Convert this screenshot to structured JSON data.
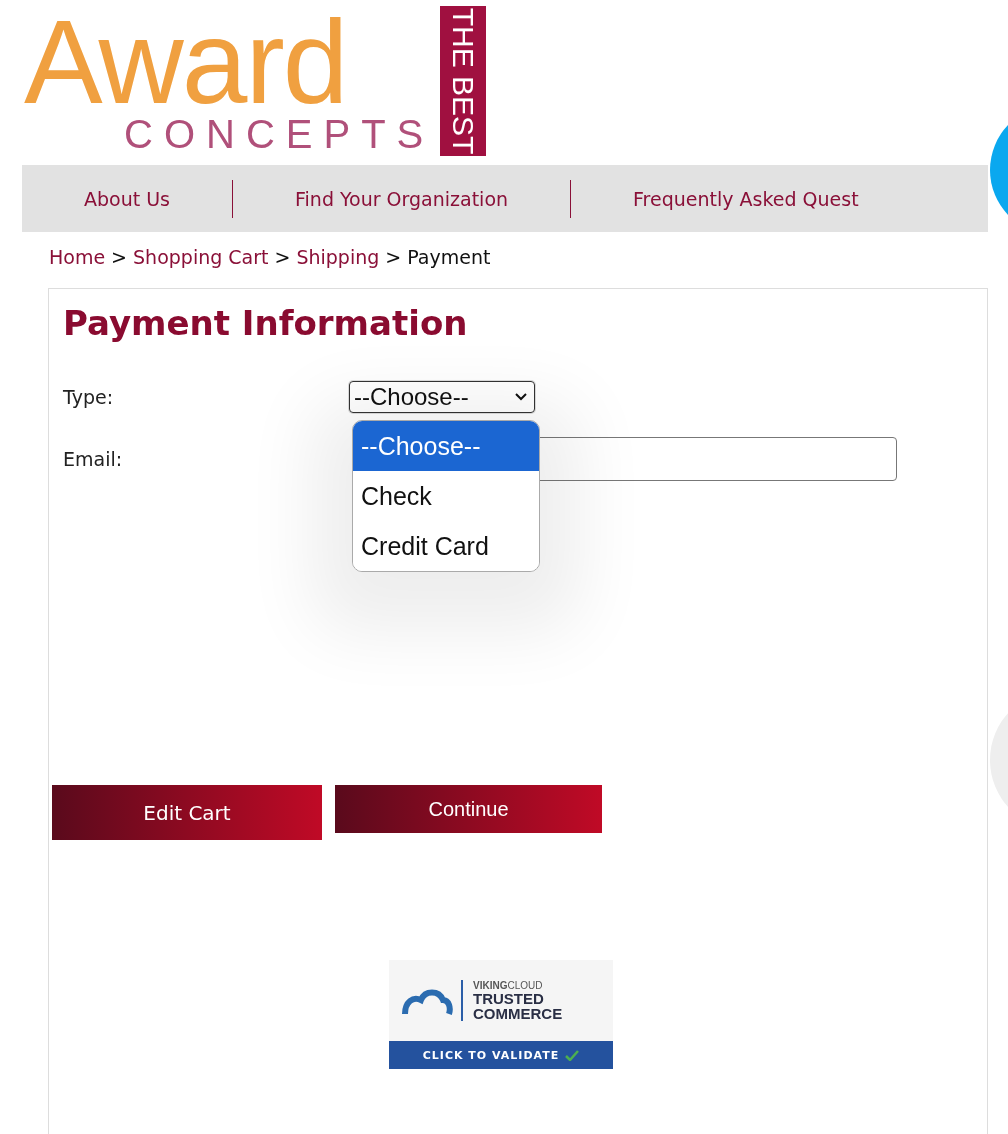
{
  "logo": {
    "word": "Award",
    "sub": "CONCEPTS",
    "tag": "THE BEST"
  },
  "nav": {
    "items": [
      {
        "label": "About Us"
      },
      {
        "label": "Find Your Organization"
      },
      {
        "label": "Frequently Asked Quest"
      }
    ]
  },
  "breadcrumb": [
    {
      "kind": "link",
      "label": "Home"
    },
    {
      "kind": "separator",
      "label": ">"
    },
    {
      "kind": "link",
      "label": "Shopping Cart"
    },
    {
      "kind": "separator",
      "label": ">"
    },
    {
      "kind": "link",
      "label": "Shipping"
    },
    {
      "kind": "separator",
      "label": ">"
    },
    {
      "kind": "current",
      "label": "Payment"
    }
  ],
  "form": {
    "heading": "Payment Information",
    "fields": [
      {
        "kind": "select",
        "label": "Type:",
        "value": "--Choose--",
        "expanded": true
      },
      {
        "kind": "text",
        "label": "Email:"
      }
    ],
    "options": [
      {
        "label": "--Choose--",
        "selected": true
      },
      {
        "label": "Check",
        "selected": false
      },
      {
        "label": "Credit Card",
        "selected": false
      }
    ]
  },
  "buttons": [
    {
      "label": "Edit Cart"
    },
    {
      "label": "Continue"
    }
  ],
  "badge": {
    "brand": "**VIKING**CLOUD",
    "line1": "TRUSTED",
    "line2": "COMMERCE",
    "action": "CLICK TO VALIDATE"
  }
}
